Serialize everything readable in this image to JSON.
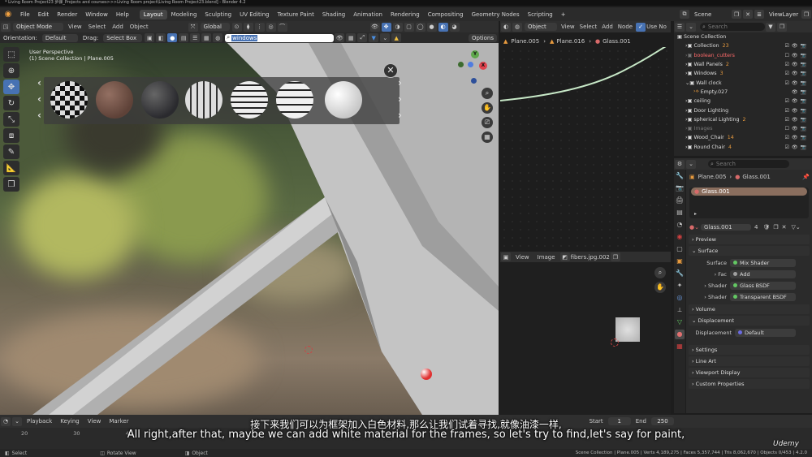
{
  "title": "* Living Room Project23 步骤_Projects and courses>>>Living Room project\\Living Room Project23.blend] - Blender 4.2",
  "menu": [
    "File",
    "Edit",
    "Render",
    "Window",
    "Help"
  ],
  "workspaces": [
    "Layout",
    "Modeling",
    "Sculpting",
    "UV Editing",
    "Texture Paint",
    "Shading",
    "Animation",
    "Rendering",
    "Compositing",
    "Geometry Nodes",
    "Scripting"
  ],
  "active_workspace": "Layout",
  "scene": "Scene",
  "viewlayer": "ViewLayer",
  "viewport_header": {
    "mode": "Object Mode",
    "view": "View",
    "select": "Select",
    "add": "Add",
    "object": "Object",
    "transform": "Global",
    "orientation_label": "Orientation:",
    "orientation": "Default",
    "drag_label": "Drag:",
    "drag": "Select Box",
    "search_value": "windows",
    "options": "Options"
  },
  "viewport": {
    "label_line1": "User Perspective",
    "label_line2": "(1) Scene Collection | Plane.005"
  },
  "material_previews": [
    "sphere-1",
    "sphere-2",
    "sphere-3",
    "sphere-4",
    "sphere-5",
    "sphere-6",
    "sphere-7"
  ],
  "node_editor": {
    "mode": "Object",
    "view": "View",
    "select": "Select",
    "add": "Add",
    "node": "Node",
    "use_nodes": "Use No",
    "breadcrumb": [
      "Plane.005",
      "Plane.016",
      "Glass.001"
    ]
  },
  "image_editor": {
    "view": "View",
    "image": "Image",
    "image_name": "fibers.jpg.002"
  },
  "outliner": {
    "search_placeholder": "Search",
    "root": "Scene Collection",
    "items": [
      {
        "name": "Collection",
        "badge": "23"
      },
      {
        "name": "boolean_cutters",
        "badge": ""
      },
      {
        "name": "Wall Panels",
        "badge": "2"
      },
      {
        "name": "Windows",
        "badge": "3"
      },
      {
        "name": "Wall clock",
        "badge": ""
      },
      {
        "name": "Empty.027",
        "badge": ""
      },
      {
        "name": "ceiling",
        "badge": ""
      },
      {
        "name": "Door Lighting",
        "badge": ""
      },
      {
        "name": "spherical Lighting",
        "badge": "2"
      },
      {
        "name": "Images",
        "badge": ""
      },
      {
        "name": "Wood_Chair",
        "badge": "14"
      },
      {
        "name": "Round Chair",
        "badge": "4"
      }
    ]
  },
  "properties": {
    "search_placeholder": "Search",
    "breadcrumb_object": "Plane.005",
    "breadcrumb_material": "Glass.001",
    "slot": "Glass.001",
    "material_name": "Glass.001",
    "users": "4",
    "preview": "Preview",
    "surface_panel": "Surface",
    "surface_label": "Surface",
    "surface_value": "Mix Shader",
    "fac_label": "Fac",
    "fac_value": "Add",
    "shader1_label": "Shader",
    "shader1_value": "Glass BSDF",
    "shader2_label": "Shader",
    "shader2_value": "Transparent BSDF",
    "volume": "Volume",
    "displacement_panel": "Displacement",
    "displacement_label": "Displacement",
    "displacement_value": "Default",
    "settings": "Settings",
    "line_art": "Line Art",
    "viewport_display": "Viewport Display",
    "custom_properties": "Custom Properties"
  },
  "timeline": {
    "playback": "Playback",
    "keying": "Keying",
    "view": "View",
    "marker": "Marker",
    "start_label": "Start",
    "start": "1",
    "end_label": "End",
    "end": "250",
    "ticks": [
      "20",
      "30",
      "40",
      "50"
    ]
  },
  "statusbar": {
    "select": "Select",
    "rotate": "Rotate View",
    "object": "Object",
    "stats": "Scene Collection | Plane.005 | Verts 4,189,275 | Faces 5,357,744 | Tris 8,062,670 | Objects 0/453 | 4.2.0"
  },
  "subtitle_cn": "接下来我们可以为框架加入白色材料,那么让我们试着寻找,就像油漆一样,",
  "subtitle_en": "All right,after that, maybe we can add white material for the frames, so let's try to find,let's say for paint,",
  "watermark": "Udemy",
  "colors": {
    "accent": "#4772b3",
    "node_color": "#f0a040",
    "material_slot": "#8a6e5e"
  }
}
